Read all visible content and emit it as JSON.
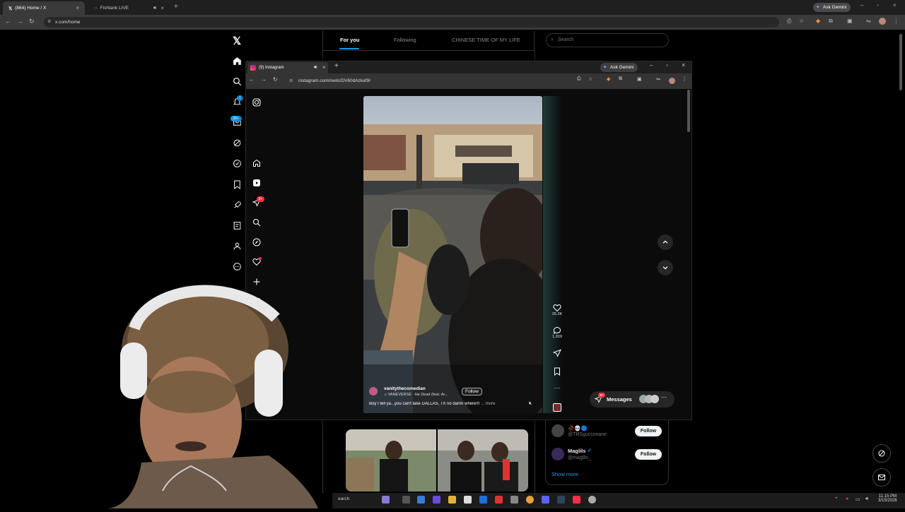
{
  "outer_browser": {
    "tabs": [
      {
        "label": "(864) Home / X",
        "active": true
      },
      {
        "label": "Fishtank LIVE",
        "active": false
      }
    ],
    "url": "x.com/home",
    "ask_gemini": "Ask Gemini"
  },
  "x": {
    "feed_tabs": [
      "For you",
      "Following",
      "CHINESE TIME OF MY LIFE"
    ],
    "search_placeholder": "Search",
    "notification_badge": "1",
    "messages_badge": "20+",
    "who_to_follow": [
      {
        "name": "🥀💀🔵",
        "handle": "@TRSguccimane",
        "follow": "Follow"
      },
      {
        "name": "Maglils",
        "handle": "@maglils_",
        "follow": "Follow"
      }
    ],
    "show_more": "Show more"
  },
  "instagram_window": {
    "tab_label": "(9) Instagram",
    "url": "instagram.com/reels/DV60dAzkaf9/",
    "ask_gemini": "Ask Gemini",
    "notif_badge": "9+",
    "reel": {
      "username": "vanitythecomedian",
      "follow_label": "Follow",
      "audio": "VANEVERSE · He Dead (feat. Ar...",
      "caption": "Boy I tell ya...you can't take DALLAS, TX no damn where!!!",
      "more": "... more",
      "likes": "25.2K",
      "comments": "1,919"
    },
    "messages_label": "Messages",
    "messages_badge": "9+"
  },
  "taskbar": {
    "search_text": "earch",
    "time": "11:15 PM",
    "date": "3/15/2026"
  },
  "colors": {
    "x_blue": "#1d9bf0",
    "ig_red": "#ff3040",
    "gemini_blue": "#4285f4"
  }
}
